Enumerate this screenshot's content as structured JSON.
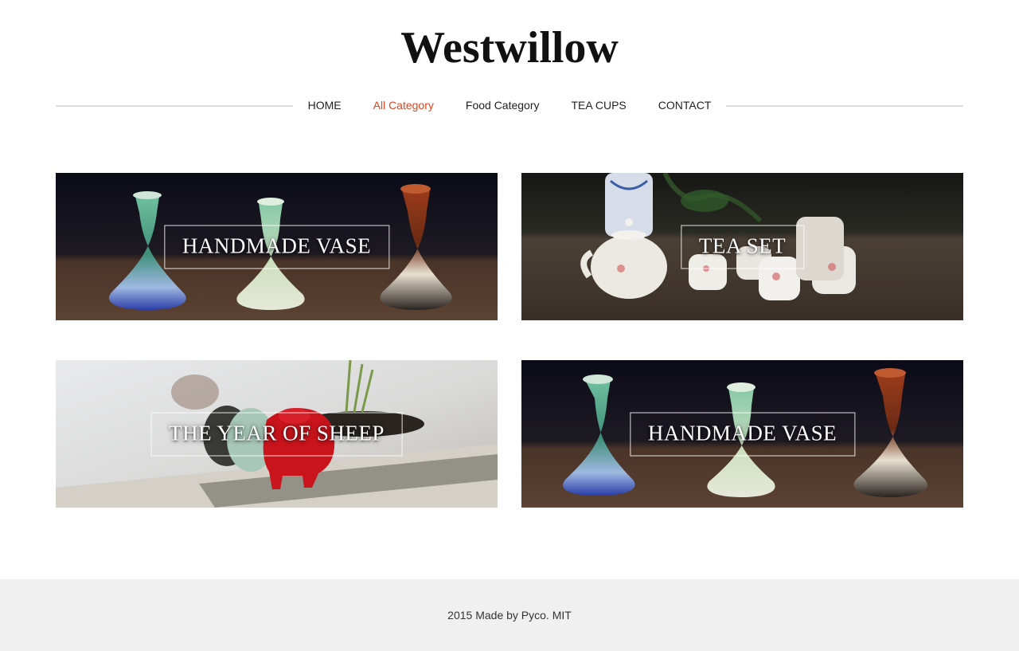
{
  "site": {
    "title": "Westwillow"
  },
  "nav": {
    "items": [
      {
        "label": "HOME"
      },
      {
        "label": "All Category"
      },
      {
        "label": "Food Category"
      },
      {
        "label": "TEA CUPS"
      },
      {
        "label": "CONTACT"
      }
    ],
    "active_index": 1
  },
  "categories": [
    {
      "title": "HANDMADE VASE"
    },
    {
      "title": "TEA SET"
    },
    {
      "title": "THE YEAR OF SHEEP"
    },
    {
      "title": "HANDMADE VASE"
    }
  ],
  "footer": {
    "text": "2015 Made by Pyco. MIT"
  },
  "colors": {
    "accent": "#e0451f",
    "footer_bg": "#f0f0f0",
    "divider": "#dddddd"
  }
}
